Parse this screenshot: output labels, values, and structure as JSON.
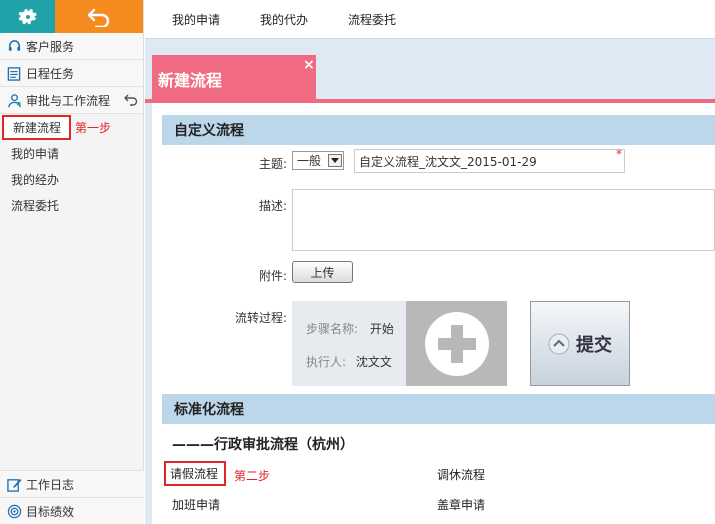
{
  "sidebar": {
    "menu": [
      {
        "label": "客户服务",
        "icon": "headset-icon"
      },
      {
        "label": "日程任务",
        "icon": "calendar-icon"
      },
      {
        "label": "审批与工作流程",
        "icon": "user-flow-icon"
      }
    ],
    "submenu": [
      {
        "label": "新建流程"
      },
      {
        "label": "我的申请"
      },
      {
        "label": "我的经办"
      },
      {
        "label": "流程委托"
      }
    ],
    "step_label": "第一步",
    "bottom": [
      {
        "label": "工作日志",
        "icon": "edit-icon"
      },
      {
        "label": "目标绩效",
        "icon": "target-icon"
      }
    ]
  },
  "topnav": [
    "我的申请",
    "我的代办",
    "流程委托"
  ],
  "tab": {
    "title": "新建流程",
    "close": "×"
  },
  "custom": {
    "title": "自定义流程",
    "subject_label": "主题:",
    "subject_select": "一般",
    "subject_value": "自定义流程_沈文文_2015-01-29",
    "required_mark": "*",
    "desc_label": "描述:",
    "attach_label": "附件:",
    "upload_label": "上传",
    "flow_label": "流转过程:",
    "step_name_key": "步骤名称:",
    "step_name_value": "开始",
    "executor_key": "执行人:",
    "executor_value": "沈文文",
    "submit_label": "提交"
  },
  "standard": {
    "title": "标准化流程",
    "group_title": "———行政审批流程（杭州）",
    "links": [
      "请假流程",
      "调休流程",
      "加班申请",
      "盖章申请"
    ],
    "step_label": "第二步"
  }
}
